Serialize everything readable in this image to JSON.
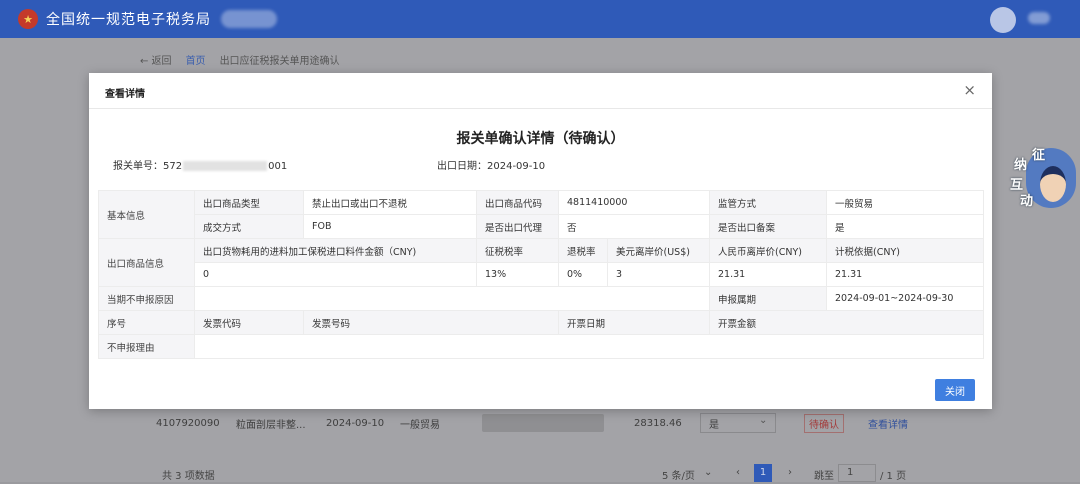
{
  "app": {
    "title": "全国统一规范电子税务局",
    "logo_icon": "tax-emblem-icon"
  },
  "breadcrumb": {
    "back": "← 返回",
    "home": "首页",
    "current": "出口应征税报关单用途确认"
  },
  "background_row": {
    "code": "4107920090",
    "name": "粒面剖层非整...",
    "date": "2024-09-10",
    "trade": "一般贸易",
    "amount": "28318.46",
    "select_value": "是",
    "confirm": "待确认",
    "detail": "查看详情"
  },
  "pager": {
    "total": "共 3 项数据",
    "page_size": "5 条/页",
    "current_page": "1",
    "goto_label": "跳至",
    "goto_value": "1",
    "total_pages": "/ 1 页"
  },
  "assistant_badge": {
    "c1": "征",
    "c2": "纳",
    "c3": "互",
    "c4": "动"
  },
  "modal": {
    "title": "查看详情",
    "close_icon": "×",
    "doc_title": "报关单确认详情（待确认）",
    "declaration_label": "报关单号：",
    "declaration_prefix": "572",
    "declaration_suffix": "001",
    "export_date_label": "出口日期：",
    "export_date": "2024-09-10",
    "close_button": "关闭"
  },
  "table": {
    "basic_info": "基本信息",
    "goods_type_label": "出口商品类型",
    "goods_type": "禁止出口或出口不退税",
    "goods_code_label": "出口商品代码",
    "goods_code": "4811410000",
    "supervision_label": "监管方式",
    "supervision": "一般贸易",
    "deal_label": "成交方式",
    "deal": "FOB",
    "agent_label": "是否出口代理",
    "agent": "否",
    "filed_label": "是否出口备案",
    "filed": "是",
    "goods_info": "出口商品信息",
    "material_label": "出口货物耗用的进料加工保税进口料件金额（CNY)",
    "levy_rate_label": "征税税率",
    "refund_rate_label": "退税率",
    "usd_fob_label": "美元离岸价(US$)",
    "cny_fob_label": "人民币离岸价(CNY)",
    "tax_basis_label": "计税依据(CNY)",
    "material": "0",
    "levy_rate": "13%",
    "refund_rate": "0%",
    "usd_fob": "3",
    "cny_fob": "21.31",
    "tax_basis": "21.31",
    "no_report_reason_label": "当期不申报原因",
    "no_report_reason": "",
    "period_label": "申报属期",
    "period": "2024-09-01~2024-09-30",
    "seq_label": "序号",
    "invoice_code_label": "发票代码",
    "invoice_no_label": "发票号码",
    "invoice_date_label": "开票日期",
    "invoice_amount_label": "开票金额",
    "no_report_item_label": "不申报理由",
    "no_report_item": ""
  }
}
